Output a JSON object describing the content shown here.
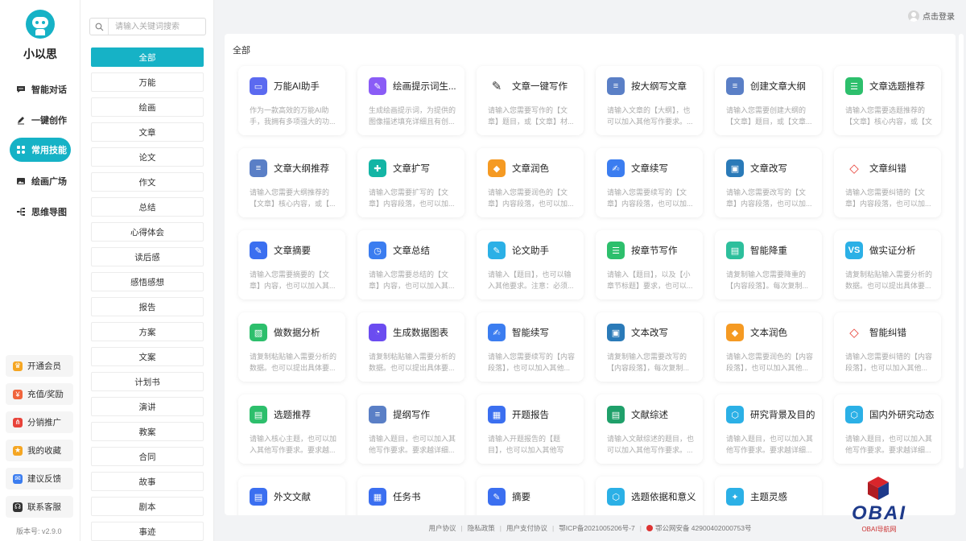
{
  "app": {
    "name": "小以思",
    "version": "版本号: v2.9.0"
  },
  "nav": [
    {
      "label": "智能对话",
      "icon": "chat-icon"
    },
    {
      "label": "一键创作",
      "icon": "pen-icon"
    },
    {
      "label": "常用技能",
      "icon": "skills-icon",
      "active": true
    },
    {
      "label": "绘画广场",
      "icon": "image-icon"
    },
    {
      "label": "思维导图",
      "icon": "mindmap-icon"
    }
  ],
  "bottom_nav": [
    {
      "label": "开通会员",
      "icon": "vip-icon",
      "color": "#f5a623"
    },
    {
      "label": "充值/奖励",
      "icon": "recharge-icon",
      "color": "#f0643c"
    },
    {
      "label": "分销推广",
      "icon": "share-icon",
      "color": "#e8433a"
    },
    {
      "label": "我的收藏",
      "icon": "star-icon",
      "color": "#f5a623"
    },
    {
      "label": "建议反馈",
      "icon": "feedback-icon",
      "color": "#3b7df0"
    },
    {
      "label": "联系客服",
      "icon": "headset-icon",
      "color": "#333333"
    }
  ],
  "search": {
    "placeholder": "请输入关键词搜索"
  },
  "categories": [
    "全部",
    "万能",
    "绘画",
    "文章",
    "论文",
    "作文",
    "总结",
    "心得体会",
    "读后感",
    "感悟感想",
    "报告",
    "方案",
    "文案",
    "计划书",
    "演讲",
    "教案",
    "合同",
    "故事",
    "剧本",
    "事迹"
  ],
  "login": "点击登录",
  "section_title": "全部",
  "cards": [
    {
      "title": "万能AI助手",
      "desc": "作为一款高效的万能AI助手，我拥有多项强大的功...",
      "color": "#5b6af0",
      "icon": "robot-icon"
    },
    {
      "title": "绘画提示词生...",
      "desc": "生成绘画提示词，为提供的图像描述填充详细且有创...",
      "color": "#8a5cf6",
      "icon": "paint-icon"
    },
    {
      "title": "文章一键写作",
      "desc": "请输入您需要写作的【文章】题目，或【文章】材...",
      "color": "#ffffff",
      "icon": "pencil-icon"
    },
    {
      "title": "按大纲写文章",
      "desc": "请输入文章的【大纲】，也可以加入其他写作要求。...",
      "color": "#5a7fc6",
      "icon": "outline-icon"
    },
    {
      "title": "创建文章大纲",
      "desc": "请输入您需要创建大纲的【文章】题目，或【文章...",
      "color": "#5a7fc6",
      "icon": "list-icon"
    },
    {
      "title": "文章选题推荐",
      "desc": "请输入您需要选题推荐的【文章】核心内容，或【文章...",
      "color": "#2dbf6c",
      "icon": "topic-icon"
    },
    {
      "title": "文章大纲推荐",
      "desc": "请输入您需要大纲推荐的【文章】核心内容，或【...",
      "color": "#5a7fc6",
      "icon": "outline-icon"
    },
    {
      "title": "文章扩写",
      "desc": "请输入您需要扩写的【文章】内容段落，也可以加...",
      "color": "#13b5a5",
      "icon": "expand-icon"
    },
    {
      "title": "文章润色",
      "desc": "请输入您需要润色的【文章】内容段落，也可以加...",
      "color": "#f59a23",
      "icon": "polish-icon"
    },
    {
      "title": "文章续写",
      "desc": "请输入您需要续写的【文章】内容段落，也可以加...",
      "color": "#3b7df0",
      "icon": "continue-icon"
    },
    {
      "title": "文章改写",
      "desc": "请输入您需要改写的【文章】内容段落，也可以加...",
      "color": "#2a7ab8",
      "icon": "rewrite-icon"
    },
    {
      "title": "文章纠错",
      "desc": "请输入您需要纠错的【文章】内容段落，也可以加...",
      "color": "#ffffff",
      "icon": "eraser-icon"
    },
    {
      "title": "文章摘要",
      "desc": "请输入您需要摘要的【文章】内容，也可以加入其...",
      "color": "#3b6ff0",
      "icon": "summary-icon"
    },
    {
      "title": "文章总结",
      "desc": "请输入您需要总结的【文章】内容，也可以加入其...",
      "color": "#3b7df0",
      "icon": "clock-doc-icon"
    },
    {
      "title": "论文助手",
      "desc": "请输入【题目】，也可以输入其他要求。注意：必须...",
      "color": "#2bb0e6",
      "icon": "compass-icon"
    },
    {
      "title": "按章节写作",
      "desc": "请输入【题目】，以及【小章节标题】要求，也可以...",
      "color": "#2dbf6c",
      "icon": "chapter-icon"
    },
    {
      "title": "智能降重",
      "desc": "请复制输入您需要降重的【内容段落】。每次复制...",
      "color": "#2dbf9c",
      "icon": "reduce-icon"
    },
    {
      "title": "做实证分析",
      "desc": "请复制粘贴输入需要分析的数据。也可以提出具体要...",
      "color": "#2bb0e6",
      "icon": "vs-icon"
    },
    {
      "title": "做数据分析",
      "desc": "请复制粘贴输入需要分析的数据。也可以提出具体要...",
      "color": "#2dbf6c",
      "icon": "chart-board-icon"
    },
    {
      "title": "生成数据图表",
      "desc": "请复制粘贴输入需要分析的数据。也可以提出具体要...",
      "color": "#6b4cf0",
      "icon": "pie-chart-icon"
    },
    {
      "title": "智能续写",
      "desc": "请输入您需要续写的【内容段落】，也可以加入其他...",
      "color": "#3b7df0",
      "icon": "continue-icon"
    },
    {
      "title": "文本改写",
      "desc": "请复制输入您需要改写的【内容段落】，每次复制...",
      "color": "#2a7ab8",
      "icon": "rewrite-icon"
    },
    {
      "title": "文本润色",
      "desc": "请输入您需要润色的【内容段落】，也可以加入其他...",
      "color": "#f59a23",
      "icon": "polish-icon"
    },
    {
      "title": "智能纠错",
      "desc": "请输入您需要纠错的【内容段落】，也可以加入其他...",
      "color": "#ffffff",
      "icon": "eraser-icon"
    },
    {
      "title": "选题推荐",
      "desc": "请输入核心主题，也可以加入其他写作要求。要求越...",
      "color": "#2dbf6c",
      "icon": "clipboard-icon"
    },
    {
      "title": "提纲写作",
      "desc": "请输入题目，也可以加入其他写作要求。要求越详细...",
      "color": "#5a7fc6",
      "icon": "outline-icon"
    },
    {
      "title": "开题报告",
      "desc": "请输入开题报告的【题目】，也可以加入其他写作...",
      "color": "#3b6ff0",
      "icon": "report-icon"
    },
    {
      "title": "文献综述",
      "desc": "请输入文献综述的题目，也可以加入其他写作要求。...",
      "color": "#1fa06a",
      "icon": "literature-icon"
    },
    {
      "title": "研究背景及目的",
      "desc": "请输入题目，也可以加入其他写作要求。要求越详细...",
      "color": "#2bb0e6",
      "icon": "hexagon-icon"
    },
    {
      "title": "国内外研究动态",
      "desc": "请输入题目，也可以加入其他写作要求。要求越详细...",
      "color": "#2bb0e6",
      "icon": "hexagon-icon"
    },
    {
      "title": "外文文献",
      "desc": "",
      "color": "#3b6ff0",
      "icon": "foreign-doc-icon"
    },
    {
      "title": "任务书",
      "desc": "",
      "color": "#3b6ff0",
      "icon": "task-icon"
    },
    {
      "title": "摘要",
      "desc": "",
      "color": "#3b6ff0",
      "icon": "summary-icon"
    },
    {
      "title": "选题依据和意义",
      "desc": "",
      "color": "#2bb0e6",
      "icon": "hexagon-icon"
    },
    {
      "title": "主题灵感",
      "desc": "",
      "color": "#2bb0e6",
      "icon": "bulb-icon"
    }
  ],
  "footer": {
    "links": [
      "用户协议",
      "隐私政策",
      "用户支付协议"
    ],
    "icp": "鄂ICP备2021005206号-7",
    "police": "鄂公网安备 42900402000753号"
  },
  "watermark": {
    "text": "OBAI",
    "sub": "OBAI导航网"
  }
}
